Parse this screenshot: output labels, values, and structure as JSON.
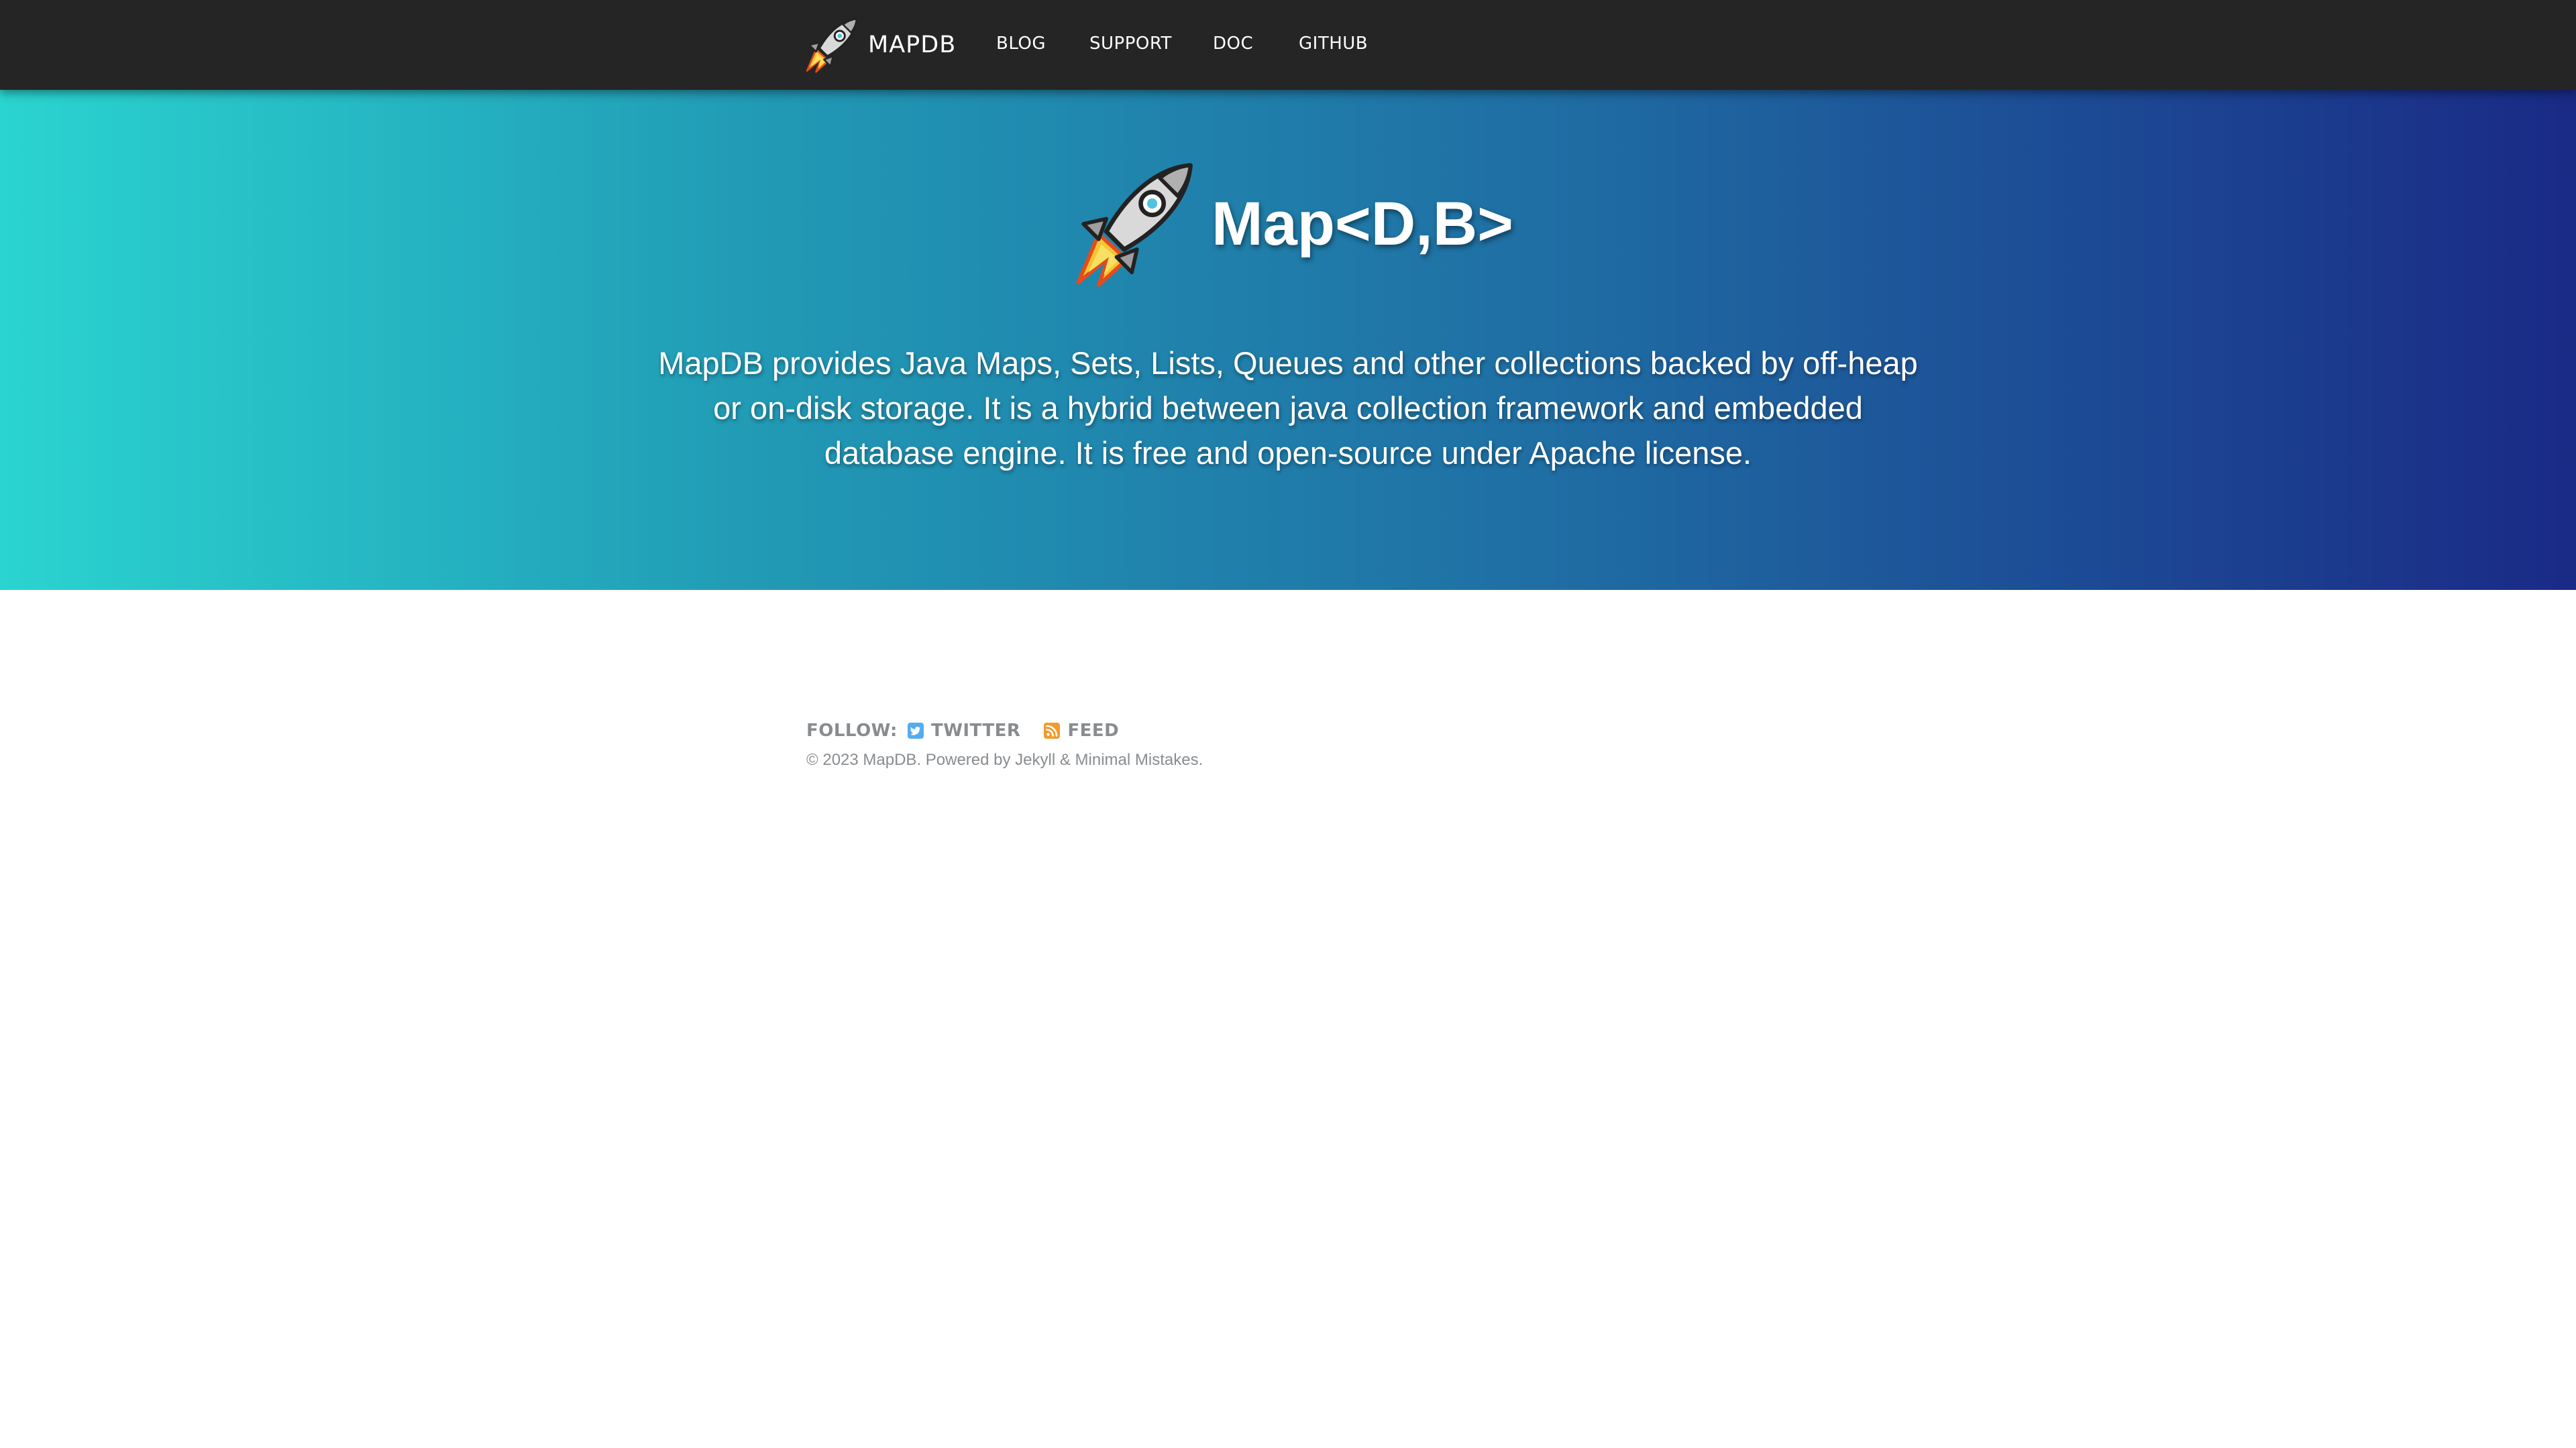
{
  "nav": {
    "brand": "MAPDB",
    "links": [
      {
        "label": "BLOG"
      },
      {
        "label": "SUPPORT"
      },
      {
        "label": "DOC"
      },
      {
        "label": "GITHUB"
      }
    ]
  },
  "hero": {
    "title": "Map<D,B>",
    "description": "MapDB provides Java Maps, Sets, Lists, Queues and other collections backed by off-heap or on-disk storage. It is a hybrid between java collection framework and embedded database engine. It is free and open-source under Apache license."
  },
  "footer": {
    "follow_label": "FOLLOW:",
    "twitter_label": "TWITTER",
    "feed_label": "FEED",
    "copyright": "© 2023 MapDB. Powered by Jekyll & Minimal Mistakes."
  },
  "icons": {
    "brand_logo": "rocket-icon",
    "hero_logo": "rocket-icon",
    "twitter": "twitter-icon",
    "feed": "rss-feed-icon"
  },
  "colors": {
    "nav_background": "#252525",
    "hero_gradient": [
      "#2ad4d0",
      "#2199b5",
      "#1f6ea4",
      "#1a2a86"
    ],
    "footer_text": "#898c8f",
    "twitter_icon": "#55acee",
    "feed_icon": "#f59a2a"
  }
}
